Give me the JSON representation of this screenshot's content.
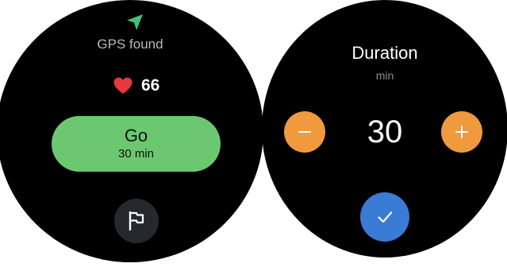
{
  "workout_screen": {
    "gps_status": "GPS found",
    "heart_rate": "66",
    "go_button": {
      "label": "Go",
      "duration": "30 min",
      "color": "#6cc870"
    },
    "icons": {
      "gps": "navigation-arrow-icon",
      "heart": "heart-icon",
      "flag": "flag-icon"
    },
    "accent_colors": {
      "gps_arrow": "#3fc37a",
      "heart": "#e8383f"
    }
  },
  "duration_screen": {
    "title": "Duration",
    "unit": "min",
    "value": "30",
    "icons": {
      "decrease": "minus-icon",
      "increase": "plus-icon",
      "confirm": "check-icon"
    },
    "colors": {
      "stepper_buttons": "#f09a3e",
      "confirm_button": "#3a7bd5"
    }
  }
}
